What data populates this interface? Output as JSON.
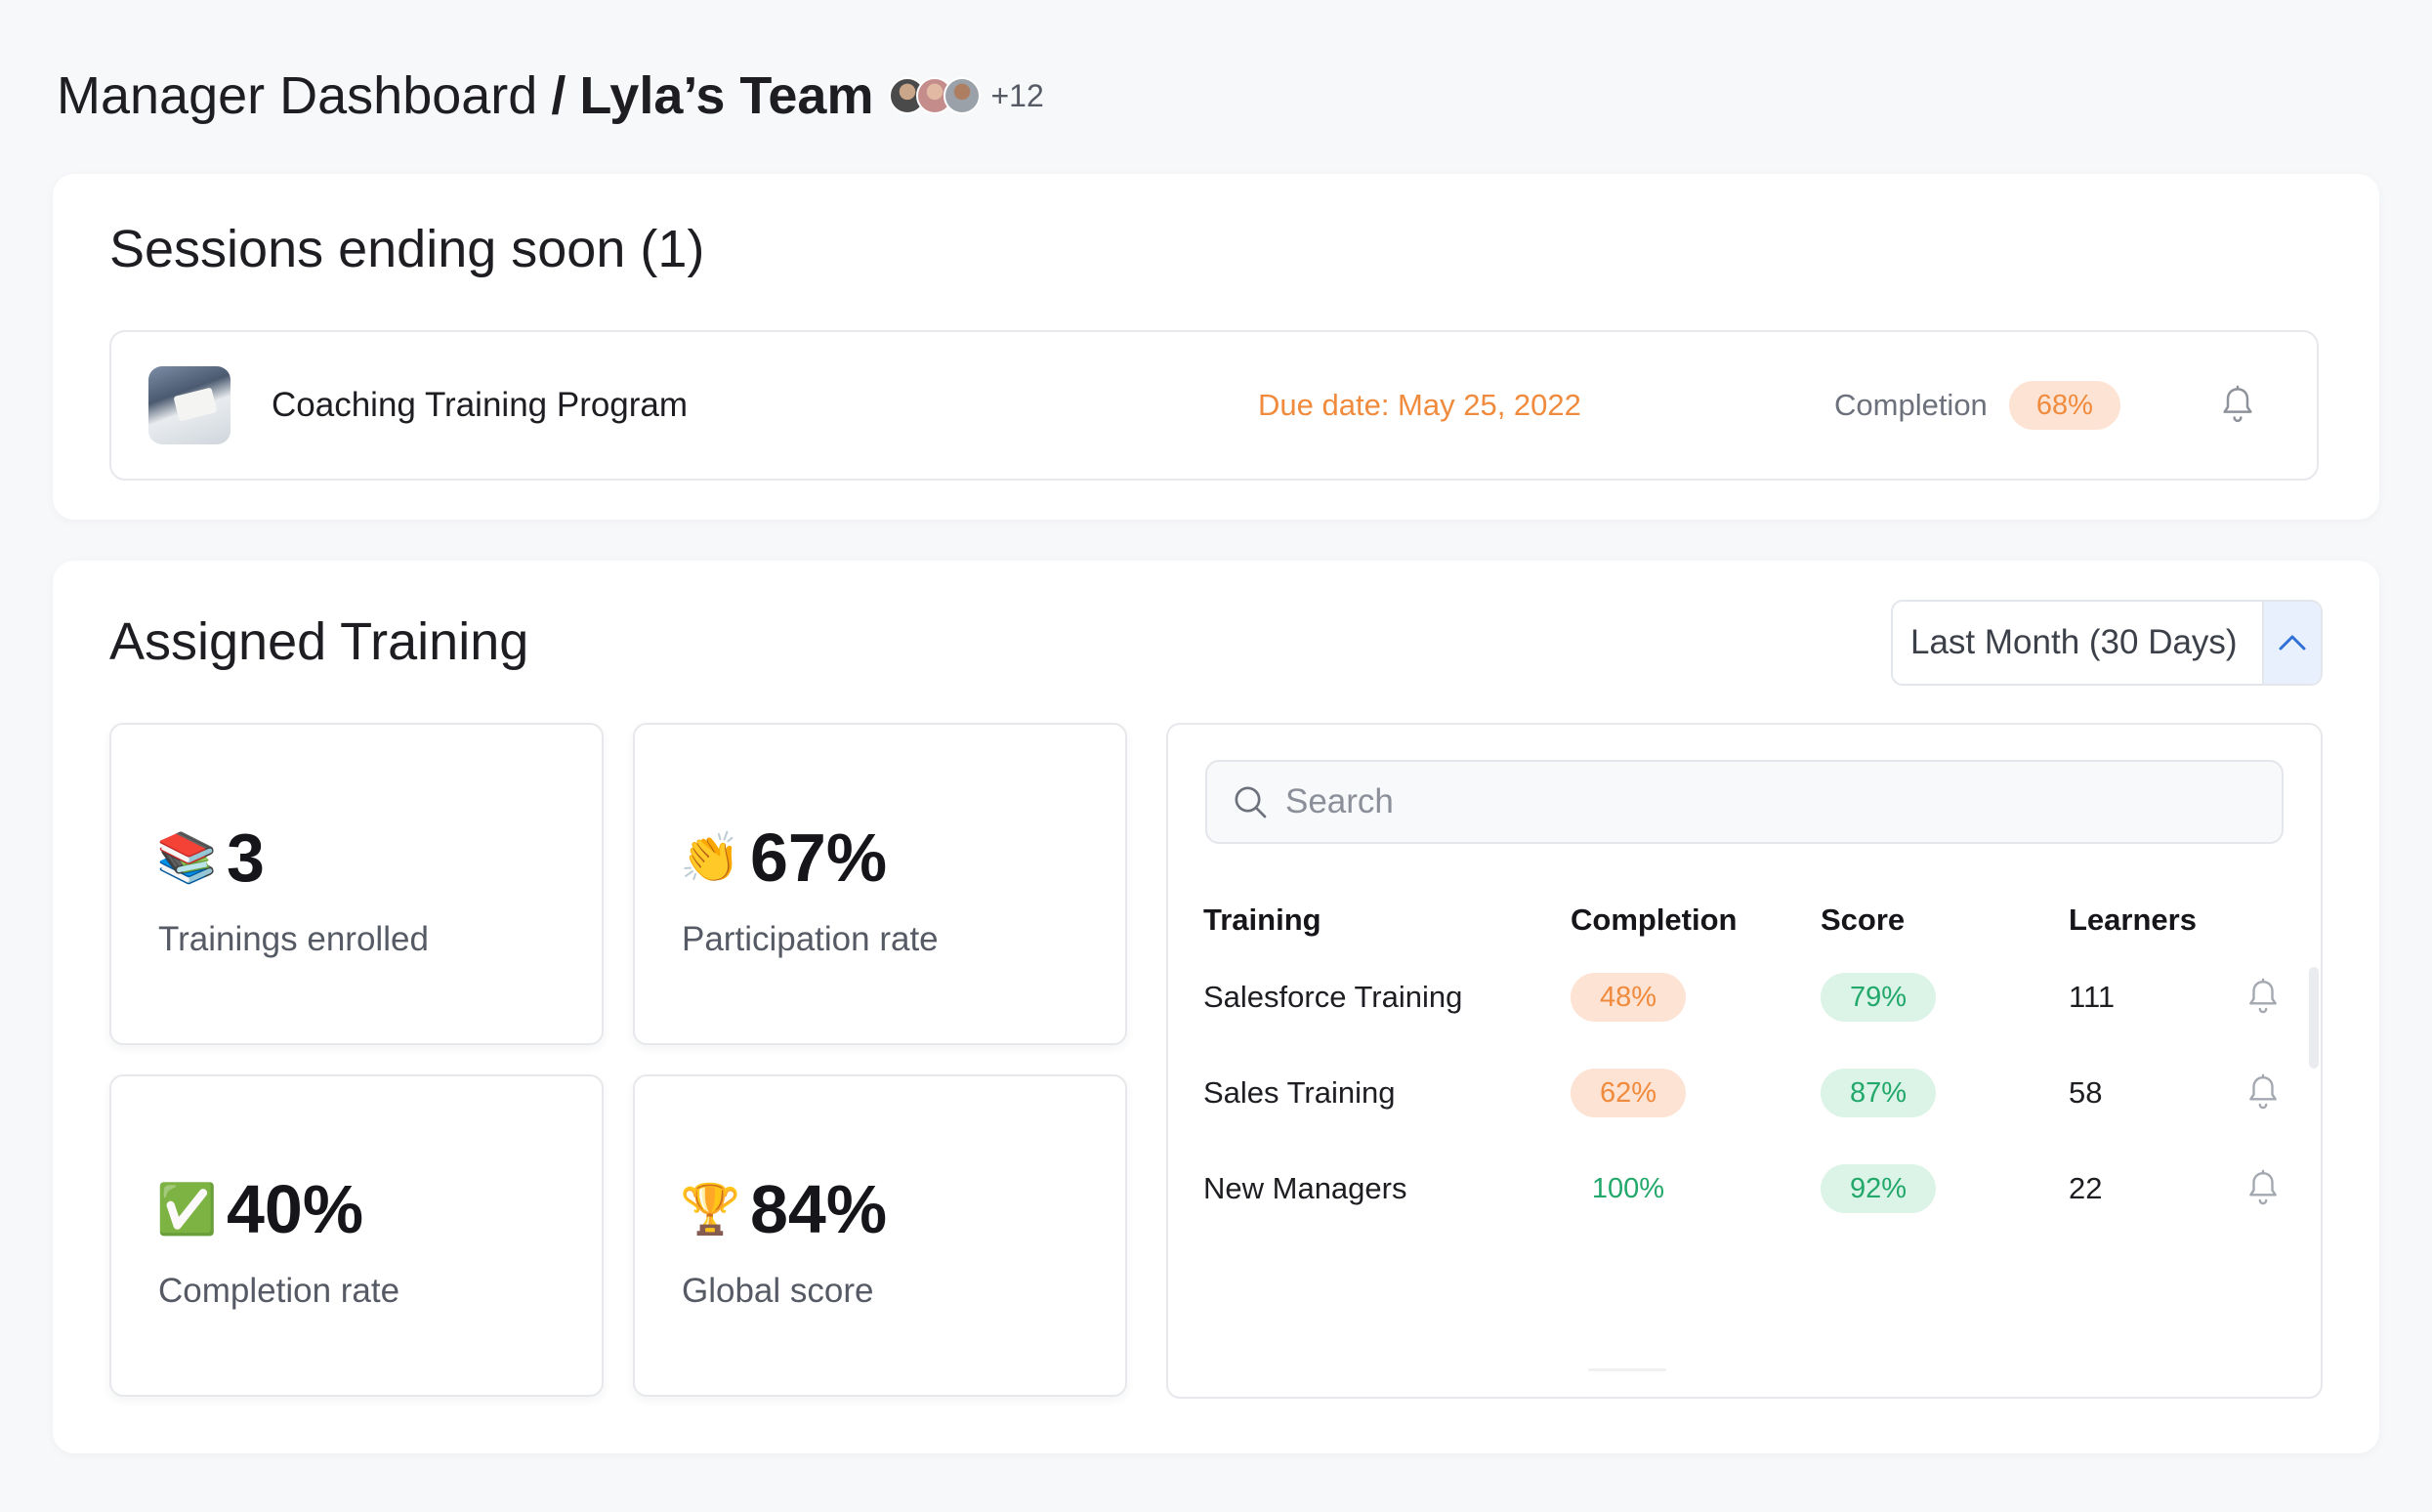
{
  "header": {
    "title": "Manager Dashboard",
    "separator": "/",
    "team": "Lyla’s Team",
    "more_members": "+12"
  },
  "sessions": {
    "title": "Sessions ending soon (1)",
    "items": [
      {
        "name": "Coaching Training Program",
        "due": "Due date: May 25, 2022",
        "completion_label": "Completion",
        "completion": "68%",
        "notify_icon": "bell-icon"
      }
    ]
  },
  "assigned": {
    "title": "Assigned Training",
    "period": "Last Month (30 Days)",
    "period_icon": "chevron-up-icon",
    "stats": [
      {
        "emoji": "📚",
        "value": "3",
        "label": "Trainings enrolled"
      },
      {
        "emoji": "👏",
        "value": "67%",
        "label": "Participation rate"
      },
      {
        "emoji": "✅",
        "value": "40%",
        "label": "Completion rate"
      },
      {
        "emoji": "🏆",
        "value": "84%",
        "label": "Global score"
      }
    ],
    "search": {
      "placeholder": "Search",
      "value": ""
    },
    "table": {
      "columns": {
        "training": "Training",
        "completion": "Completion",
        "score": "Score",
        "learners": "Learners"
      },
      "rows": [
        {
          "training": "Salesforce Training",
          "completion": "48%",
          "score": "79%",
          "learners": "111"
        },
        {
          "training": "Sales Training",
          "completion": "62%",
          "score": "87%",
          "learners": "58"
        },
        {
          "training": "New Managers",
          "completion": "100%",
          "score": "92%",
          "learners": "22"
        }
      ]
    }
  },
  "colors": {
    "accent_orange": "#f08a3c",
    "pill_orange_bg": "#fde3d3",
    "accent_green": "#22a86b",
    "pill_green_bg": "#dcf3e7",
    "dropdown_toggle_bg": "#e8f0fd",
    "chevron_blue": "#2f6fd6"
  }
}
